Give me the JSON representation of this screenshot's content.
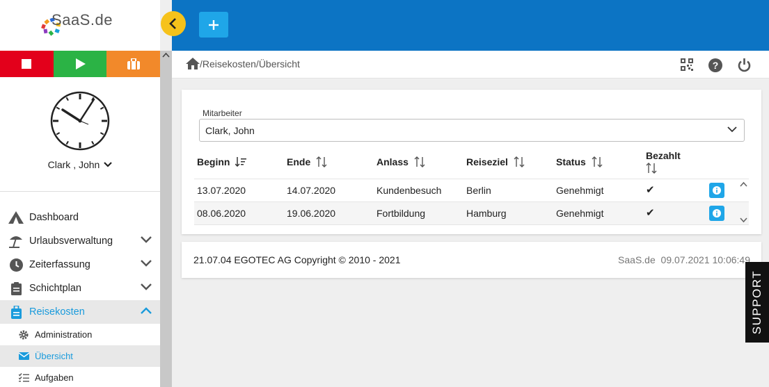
{
  "logo": {
    "name": "SaaS",
    "suffix": ".de"
  },
  "clock_user": "Clark , John",
  "nav": {
    "dashboard": "Dashboard",
    "urlaub": "Urlaubsverwaltung",
    "zeit": "Zeiterfassung",
    "schicht": "Schichtplan",
    "reise": "Reisekosten",
    "sub": {
      "administration": "Administration",
      "uebersicht": "Übersicht",
      "aufgaben": "Aufgaben"
    }
  },
  "breadcrumb": "/Reisekosten/Übersicht",
  "filter": {
    "label": "Mitarbeiter",
    "value": "Clark, John"
  },
  "table": {
    "headers": {
      "beginn": "Beginn",
      "ende": "Ende",
      "anlass": "Anlass",
      "reiseziel": "Reiseziel",
      "status": "Status",
      "bezahlt": "Bezahlt"
    },
    "rows": [
      {
        "beginn": "13.07.2020",
        "ende": "14.07.2020",
        "anlass": "Kundenbesuch",
        "reiseziel": "Berlin",
        "status": "Genehmigt",
        "bezahlt": "✔"
      },
      {
        "beginn": "08.06.2020",
        "ende": "19.06.2020",
        "anlass": "Fortbildung",
        "reiseziel": "Hamburg",
        "status": "Genehmigt",
        "bezahlt": "✔"
      }
    ]
  },
  "footer": {
    "copyright": "21.07.04 EGOTEC AG Copyright © 2010 - 2021",
    "product": "SaaS.de",
    "timestamp": "09.07.2021 10:06:49"
  },
  "support": "SUPPORT",
  "colors": {
    "topbar": "#0c74c4",
    "accent": "#1fa6e8",
    "stop": "#e3001b",
    "play": "#2bb345",
    "case": "#f2892a",
    "collapse": "#f6c21b"
  }
}
